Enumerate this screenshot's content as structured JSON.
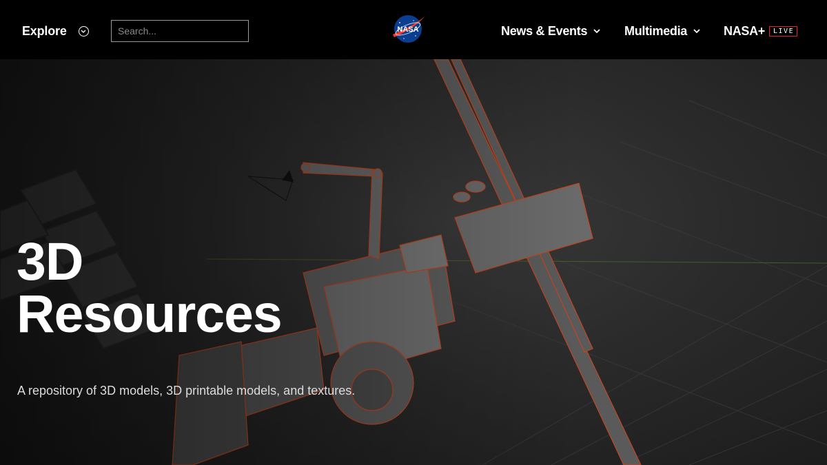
{
  "header": {
    "explore_label": "Explore",
    "search_placeholder": "Search...",
    "logo_text": "NASA",
    "nav": [
      {
        "label": "News & Events"
      },
      {
        "label": "Multimedia"
      },
      {
        "label": "NASA+",
        "badge": "LIVE"
      }
    ]
  },
  "hero": {
    "title_line1": "3D",
    "title_line2": "Resources",
    "subtitle": "A repository of 3D models, 3D printable models, and textures."
  },
  "colors": {
    "header_bg": "#000000",
    "hero_bg": "#2a2a2a",
    "live_border": "#e4282a",
    "nasa_blue": "#0b3d91",
    "nasa_red": "#fc3d21",
    "wireframe_orange": "#c4461e"
  },
  "icons": {
    "explore": "chevron-circle-icon",
    "nav_dropdown": "chevron-down-icon"
  }
}
